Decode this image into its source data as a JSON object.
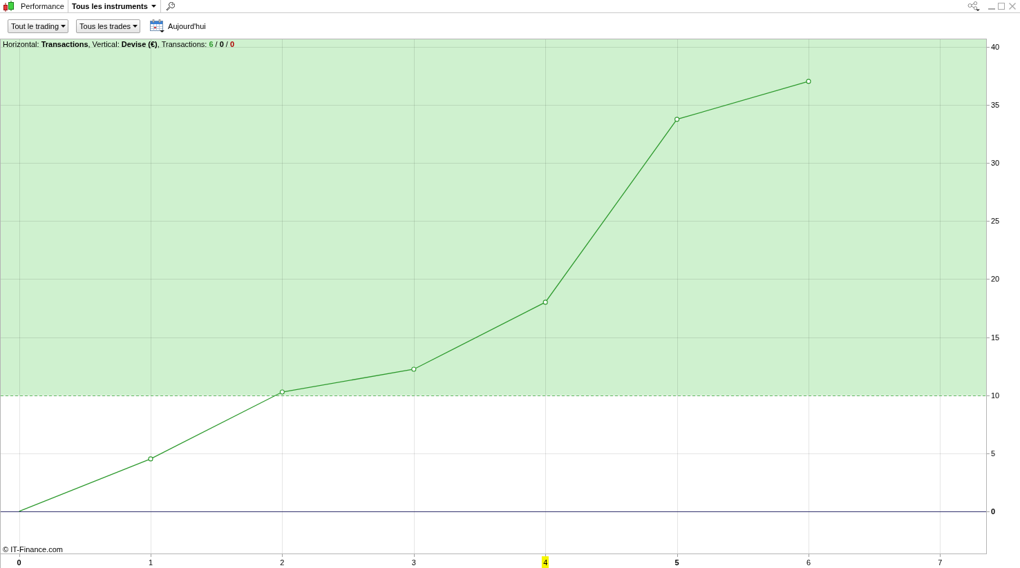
{
  "window": {
    "title": "Performance"
  },
  "instrument_selector": {
    "label": "Tous les instruments"
  },
  "toolbar": {
    "filters": [
      {
        "label": "Tout le trading"
      },
      {
        "label": "Tous les trades"
      }
    ],
    "date_button": {
      "label": "Aujourd'hui"
    }
  },
  "chart": {
    "caption": {
      "text": "Horizontal: **Transactions**, Vertical: **Devise (€)**, Transactions: ",
      "separator": " / ",
      "counts": [
        {
          "value": "6",
          "color": "#2e9a2e"
        },
        {
          "value": "0",
          "color": "#000000"
        },
        {
          "value": "0",
          "color": "#b00000"
        }
      ]
    },
    "y_axis_labels": [
      {
        "text": "40",
        "bold": false
      },
      {
        "text": "35",
        "bold": false
      },
      {
        "text": "30",
        "bold": false
      },
      {
        "text": "25",
        "bold": false
      },
      {
        "text": "20",
        "bold": false
      },
      {
        "text": "15",
        "bold": false
      },
      {
        "text": "10",
        "bold": false
      },
      {
        "text": "5",
        "bold": false
      },
      {
        "text": "0",
        "bold": true
      }
    ],
    "credit": "© IT-Finance.com",
    "x_axis_labels": [
      {
        "text": "0",
        "bold": true,
        "highlighted": false
      },
      {
        "text": "1",
        "bold": false,
        "highlighted": false
      },
      {
        "text": "2",
        "bold": false,
        "highlighted": false
      },
      {
        "text": "3",
        "bold": false,
        "highlighted": false
      },
      {
        "text": "4",
        "bold": false,
        "highlighted": true
      },
      {
        "text": "5",
        "bold": true,
        "highlighted": false
      },
      {
        "text": "6",
        "bold": false,
        "highlighted": false
      },
      {
        "text": "7",
        "bold": false,
        "highlighted": false
      }
    ],
    "chart_data": {
      "type": "line",
      "x": [
        0,
        1,
        2,
        3,
        4,
        5,
        6
      ],
      "series": [
        {
          "color": "#2e9a2e",
          "marker": "circle",
          "values": [
            0,
            4.52,
            10.28,
            12.24,
            18.01,
            33.76,
            37.03
          ]
        }
      ],
      "xlim": [
        -0.14,
        7.35
      ],
      "ylim": [
        -3.63,
        40.71
      ],
      "xticks": [
        0,
        1,
        2,
        3,
        4,
        5,
        6,
        7
      ],
      "yticks": [
        0,
        5,
        10,
        15,
        20,
        25,
        30,
        35,
        40
      ],
      "grid": true,
      "bands": [
        {
          "axis": "y",
          "from": 10,
          "to": 40.71,
          "color": "#cff1cf"
        }
      ],
      "ref_lines": [
        {
          "axis": "y",
          "value": 10,
          "color": "#5cb65c"
        },
        {
          "axis": "y",
          "value": 0,
          "color": "#30306c"
        }
      ]
    }
  }
}
